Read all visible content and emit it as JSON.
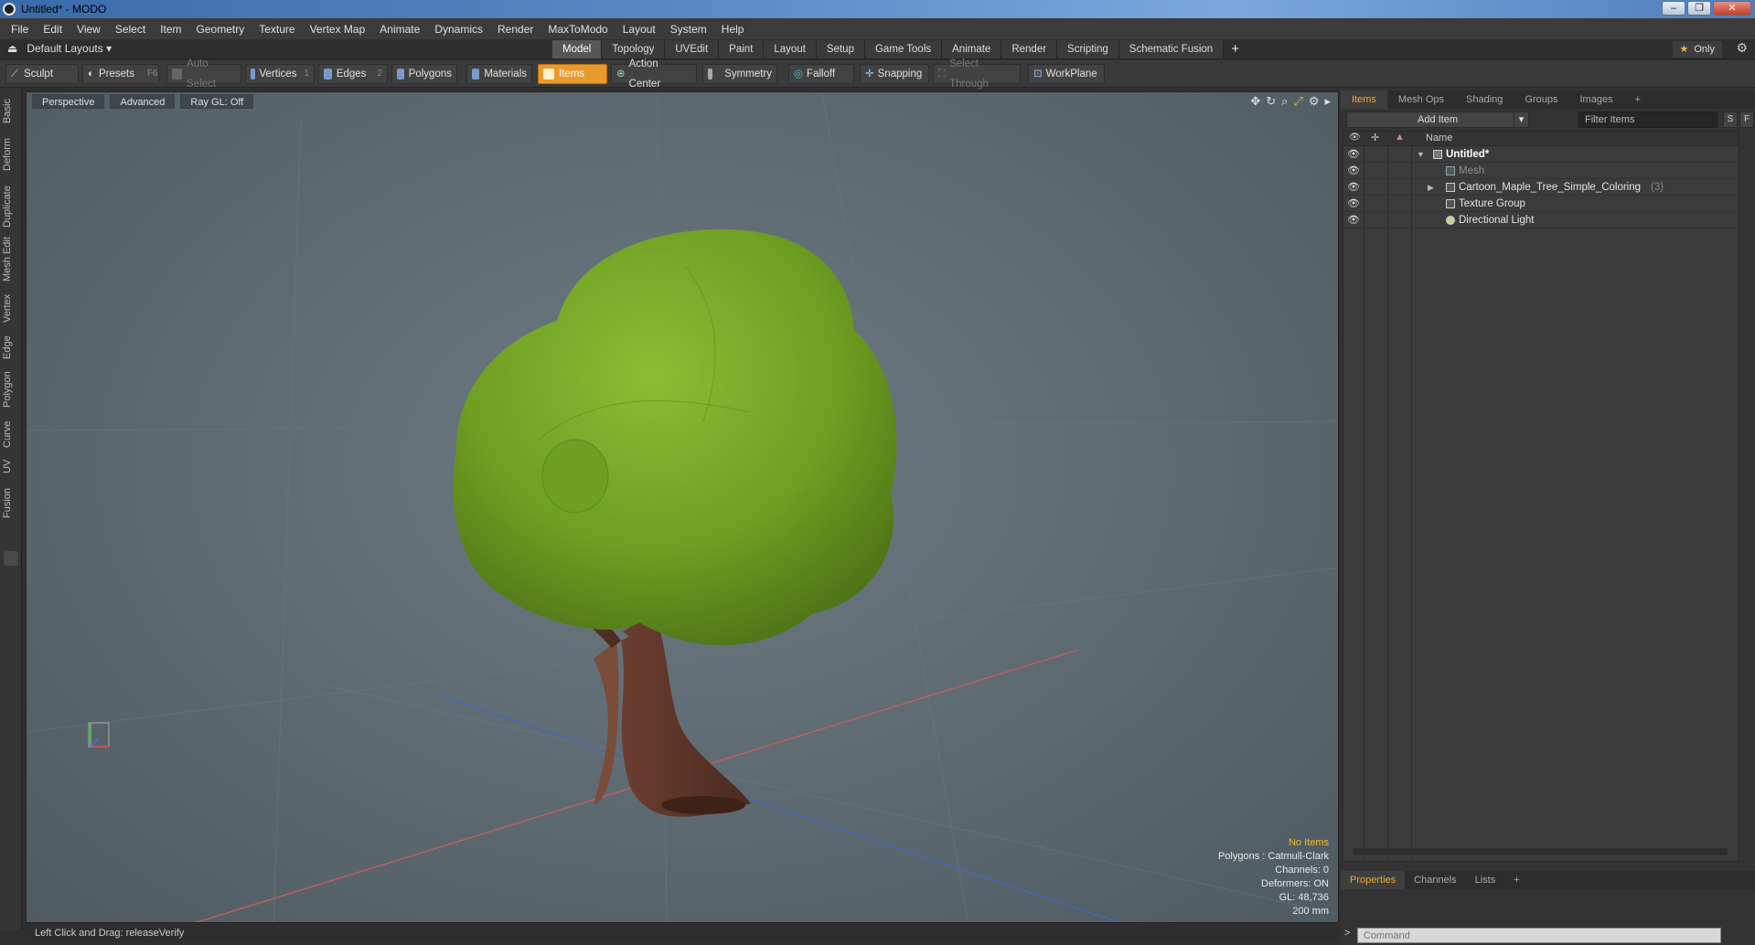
{
  "window": {
    "title": "Untitled* - MODO",
    "minimize": "–",
    "maximize": "❐",
    "close": "✕"
  },
  "menu": [
    "File",
    "Edit",
    "View",
    "Select",
    "Item",
    "Geometry",
    "Texture",
    "Vertex Map",
    "Animate",
    "Dynamics",
    "Render",
    "MaxToModo",
    "Layout",
    "System",
    "Help"
  ],
  "layout": {
    "preset": "Default Layouts ▾",
    "tabs": [
      "Model",
      "Topology",
      "UVEdit",
      "Paint",
      "Layout",
      "Setup",
      "Game Tools",
      "Animate",
      "Render",
      "Scripting",
      "Schematic Fusion"
    ],
    "active_tab": "Model",
    "add": "+",
    "only": "Only"
  },
  "toolbar": {
    "sculpt": "Sculpt",
    "presets": "Presets",
    "presets_key": "F6",
    "auto_select": "Auto Select",
    "vertices": "Vertices",
    "vertices_key": "1",
    "edges": "Edges",
    "edges_key": "2",
    "polygons": "Polygons",
    "materials": "Materials",
    "items": "Items",
    "action_center": "Action Center",
    "symmetry": "Symmetry",
    "falloff": "Falloff",
    "snapping": "Snapping",
    "select_through": "Select Through",
    "workplane": "WorkPlane"
  },
  "left_tabs": [
    "Basic",
    "Deform",
    "Duplicate",
    "Mesh Edit",
    "Vertex",
    "Edge",
    "Polygon",
    "Curve",
    "UV",
    "Fusion"
  ],
  "viewport": {
    "view": "Perspective",
    "mode": "Advanced",
    "raygl": "Ray GL: Off",
    "info": {
      "no_items": "No Items",
      "polygons": "Polygons : Catmull-Clark",
      "channels": "Channels: 0",
      "deformers": "Deformers: ON",
      "gl": "GL: 48,736",
      "grid": "200 mm"
    }
  },
  "status": "Left Click and Drag:   releaseVerify",
  "right_panel": {
    "tabs": [
      "Items",
      "Mesh Ops",
      "Shading",
      "Groups",
      "Images",
      "+"
    ],
    "add_item": "Add Item",
    "filter_placeholder": "Filter Items",
    "s_btn": "S",
    "f_btn": "F",
    "column_name": "Name",
    "tree": [
      {
        "label": "Untitled*"
      },
      {
        "label": "Mesh"
      },
      {
        "label": "Cartoon_Maple_Tree_Simple_Coloring",
        "count": "(3)"
      },
      {
        "label": "Texture Group"
      },
      {
        "label": "Directional Light"
      }
    ],
    "bottom_tabs": [
      "Properties",
      "Channels",
      "Lists",
      "+"
    ],
    "command_placeholder": "Command",
    "command_prompt": ">"
  },
  "colors": {
    "accent": "#f0a830",
    "items_active": "#e89a2e",
    "foliage": "#7aa82e",
    "trunk": "#5a3428"
  }
}
